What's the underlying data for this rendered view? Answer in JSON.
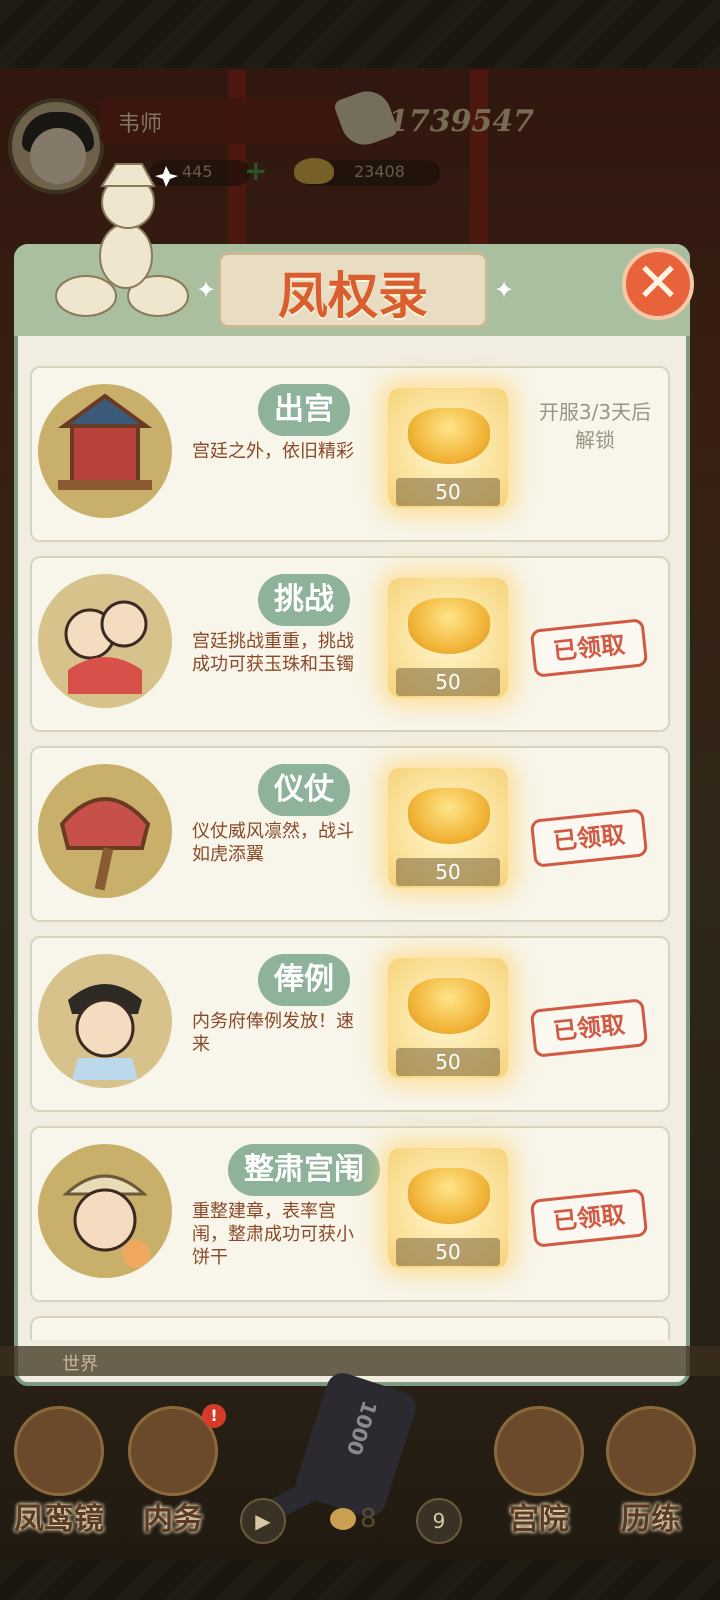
{
  "player": {
    "name": "韦师",
    "power": "1739547",
    "resource_a": "445",
    "resource_b": "23408"
  },
  "panel": {
    "title": "凤权录",
    "close_icon": "close-icon"
  },
  "entries": [
    {
      "tag": "出宫",
      "desc": "宫廷之外，依旧精彩",
      "icon": "sedan-chair-icon",
      "reward": "50",
      "status_type": "locked",
      "status": "开服3/3天后解锁"
    },
    {
      "tag": "挑战",
      "desc": "宫廷挑战重重，挑战成功可获玉珠和玉镯",
      "icon": "consorts-icon",
      "reward": "50",
      "status_type": "claimed",
      "status": "已领取"
    },
    {
      "tag": "仪仗",
      "desc": "仪仗威风凛然，战斗如虎添翼",
      "icon": "canopy-icon",
      "reward": "50",
      "status_type": "claimed",
      "status": "已领取"
    },
    {
      "tag": "俸例",
      "desc": "内务府俸例发放！速来",
      "icon": "eunuch-icon",
      "reward": "50",
      "status_type": "claimed",
      "status": "已领取"
    },
    {
      "tag": "整肃宫闱",
      "desc": "重整建章，表率宫闱，整肃成功可获小饼干",
      "icon": "official-icon",
      "reward": "50",
      "status_type": "claimed",
      "status": "已领取"
    }
  ],
  "chat": {
    "label": "世界"
  },
  "nav": {
    "mirror": "凤鸾镜",
    "affairs": "内务",
    "palace": "宫院",
    "training": "历练",
    "count_coin": "8",
    "count_round": "9",
    "hammer_label": "1000"
  },
  "colors": {
    "title": "#d9602e",
    "tag_bg": "#8fb39a",
    "desc": "#8a4a2a",
    "stamp": "#d05a44",
    "panel_border": "#7d9a82"
  }
}
